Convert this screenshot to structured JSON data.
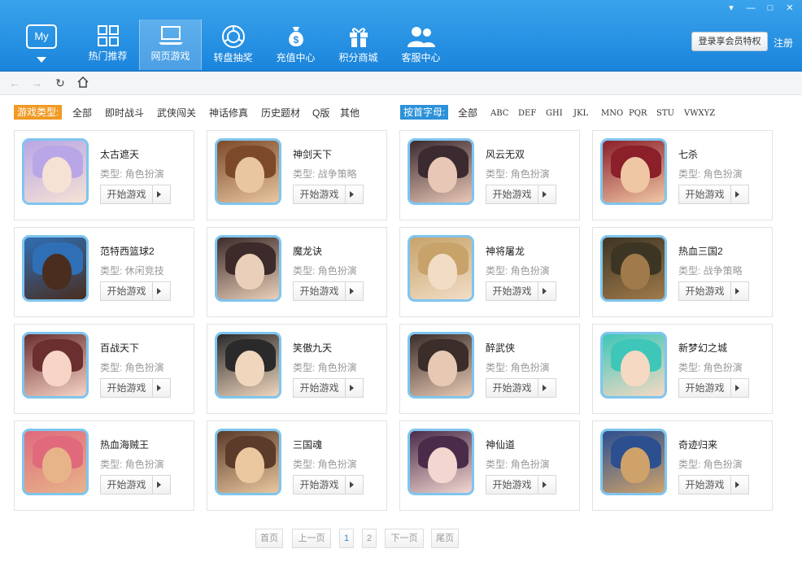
{
  "header": {
    "logo_label": "My",
    "nav": [
      {
        "label": "热门推荐",
        "icon": "grid-icon"
      },
      {
        "label": "网页游戏",
        "icon": "laptop-icon",
        "active": true
      },
      {
        "label": "转盘抽奖",
        "icon": "wheel-icon"
      },
      {
        "label": "充值中心",
        "icon": "moneybag-icon"
      },
      {
        "label": "积分商城",
        "icon": "gift-icon"
      },
      {
        "label": "客服中心",
        "icon": "customer-service-icon"
      }
    ],
    "member_button": "登录享会员特权",
    "register_link": "注册",
    "window_controls": [
      "▾",
      "—",
      "□",
      "✕"
    ]
  },
  "toolbar": {
    "back": "back-arrow-icon",
    "forward": "forward-arrow-icon",
    "refresh": "refresh-icon",
    "home": "home-icon"
  },
  "filters": {
    "type_label": "游戏类型:",
    "type_options": [
      "全部",
      "即时战斗",
      "武侠闯关",
      "神话修真",
      "历史题材",
      "Q版",
      "其他"
    ],
    "alpha_label": "按首字母:",
    "alpha_options": [
      "全部",
      "ABC",
      "DEF",
      "GHI",
      "JKL",
      "MNO",
      "PQR",
      "STU",
      "VWXYZ"
    ]
  },
  "play_label": "开始游戏",
  "games": [
    {
      "name": "太古遮天",
      "type": "类型: 角色扮演",
      "colors": [
        "#b9a6e6",
        "#f6e2d4"
      ]
    },
    {
      "name": "神剑天下",
      "type": "类型: 战争策略",
      "colors": [
        "#7c4a2a",
        "#e9c6a0"
      ]
    },
    {
      "name": "风云无双",
      "type": "类型: 角色扮演",
      "colors": [
        "#3b2a30",
        "#e9c7b6"
      ]
    },
    {
      "name": "七杀",
      "type": "类型: 角色扮演",
      "colors": [
        "#8b1f2a",
        "#f0c7a4"
      ]
    },
    {
      "name": "范特西篮球2",
      "type": "类型: 休闲竞技",
      "colors": [
        "#2f6fb5",
        "#4a2d1e"
      ]
    },
    {
      "name": "魔龙诀",
      "type": "类型: 角色扮演",
      "colors": [
        "#3c2b2a",
        "#ead0ba"
      ]
    },
    {
      "name": "神将屠龙",
      "type": "类型: 角色扮演",
      "colors": [
        "#c7a36a",
        "#f1ddc6"
      ]
    },
    {
      "name": "热血三国2",
      "type": "类型: 战争策略",
      "colors": [
        "#3d3524",
        "#a07a4a"
      ]
    },
    {
      "name": "百战天下",
      "type": "类型: 角色扮演",
      "colors": [
        "#6b2f2f",
        "#f7d4c6"
      ]
    },
    {
      "name": "笑傲九天",
      "type": "类型: 角色扮演",
      "colors": [
        "#2a2a2a",
        "#efd6bd"
      ]
    },
    {
      "name": "醉武侠",
      "type": "类型: 角色扮演",
      "colors": [
        "#3a2d2a",
        "#e7c8b3"
      ]
    },
    {
      "name": "新梦幻之城",
      "type": "类型: 角色扮演",
      "colors": [
        "#3ec7b8",
        "#f6d9c3"
      ]
    },
    {
      "name": "热血海贼王",
      "type": "类型: 角色扮演",
      "colors": [
        "#e06a7c",
        "#e7b48a"
      ]
    },
    {
      "name": "三国魂",
      "type": "类型: 角色扮演",
      "colors": [
        "#5b3b2a",
        "#eac79e"
      ]
    },
    {
      "name": "神仙道",
      "type": "类型: 角色扮演",
      "colors": [
        "#4a2c4a",
        "#f2d6cf"
      ]
    },
    {
      "name": "奇迹归来",
      "type": "类型: 角色扮演",
      "colors": [
        "#2c4f8f",
        "#cfa26a"
      ]
    }
  ],
  "pagination": {
    "first": "首页",
    "prev": "上一页",
    "pages": [
      "1",
      "2"
    ],
    "current": "1",
    "next": "下一页",
    "last": "尾页"
  }
}
